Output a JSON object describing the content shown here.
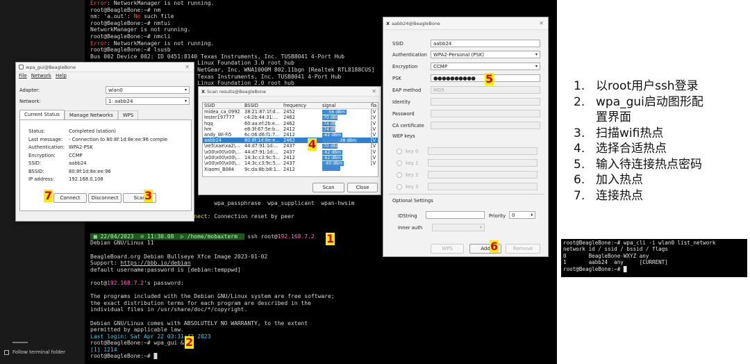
{
  "terminal": {
    "lines": [
      {
        "parts": [
          {
            "t": "Error",
            "c": "red"
          },
          {
            "t": ": NetworkManager is not running."
          }
        ]
      },
      {
        "parts": [
          {
            "t": "root@BeagleBone:~# nm"
          }
        ]
      },
      {
        "parts": [
          {
            "t": "nm: 'a.out': "
          },
          {
            "t": "No",
            "c": "red"
          },
          {
            "t": " such file"
          }
        ]
      },
      {
        "parts": [
          {
            "t": "root@BeagleBone:~# nmtui"
          }
        ]
      },
      {
        "parts": [
          {
            "t": "NetworkManager is not running."
          }
        ]
      },
      {
        "parts": [
          {
            "t": "root@BeagleBone:~# nmcli"
          }
        ]
      },
      {
        "parts": [
          {
            "t": "Error",
            "c": "red"
          },
          {
            "t": ": NetworkManager is not running."
          }
        ]
      },
      {
        "parts": [
          {
            "t": "root@BeagleBone:~# lsusb"
          }
        ]
      },
      {
        "parts": [
          {
            "t": "Bus 002 Device 002: ID 0451:8140 Texas Instruments, Inc. TUSB8041 4-Port Hub"
          }
        ]
      },
      {
        "parts": [
          {
            "t": "                                Linux Foundation 3.0 root hub"
          }
        ]
      },
      {
        "parts": [
          {
            "t": "                                NetGear, Inc. WNA1000M 802.11bgn [Realtek RTL8188CUS]"
          }
        ]
      },
      {
        "parts": [
          {
            "t": "                                Texas Instruments, Inc. TUSB8041 4-Port Hub"
          }
        ]
      },
      {
        "parts": [
          {
            "t": "                                Linux Foundation 2.0 root hub"
          }
        ]
      },
      {
        "parts": [
          {
            "t": ""
          }
        ]
      },
      {
        "parts": [
          {
            "t": ""
          }
        ]
      },
      {
        "parts": [
          {
            "t": ""
          }
        ]
      },
      {
        "parts": [
          {
            "t": ""
          }
        ]
      },
      {
        "parts": [
          {
            "t": ""
          }
        ]
      },
      {
        "parts": [
          {
            "t": ""
          }
        ]
      },
      {
        "parts": [
          {
            "t": ""
          }
        ]
      },
      {
        "parts": [
          {
            "t": ""
          }
        ]
      },
      {
        "parts": [
          {
            "t": ""
          }
        ]
      },
      {
        "parts": [
          {
            "t": ""
          }
        ]
      },
      {
        "parts": [
          {
            "t": ""
          }
        ]
      },
      {
        "parts": [
          {
            "t": ""
          }
        ]
      },
      {
        "parts": [
          {
            "t": ""
          }
        ]
      },
      {
        "parts": [
          {
            "t": ""
          }
        ]
      },
      {
        "parts": [
          {
            "t": ""
          }
        ]
      },
      {
        "parts": [
          {
            "t": ""
          }
        ]
      },
      {
        "parts": [
          {
            "t": ""
          }
        ]
      },
      {
        "parts": [
          {
            "t": "                    wpa_gui          wpa_passphrase  wpa_supplicant  wpan-hwsim"
          }
        ]
      },
      {
        "parts": [
          {
            "t": ""
          }
        ]
      },
      {
        "parts": [
          {
            "t": "                    send "
          },
          {
            "t": "disconnect",
            "c": "ylw"
          },
          {
            "t": ": Connection reset by peer"
          }
        ]
      },
      {
        "parts": [
          {
            "t": ""
          }
        ]
      },
      {
        "parts": [
          {
            "t": ""
          }
        ]
      },
      {
        "parts": [
          {
            "t": " ▦ 22/04/2023  ⊙ 11:30.08  ▷ /home/mobaxterm  ",
            "c": "grn"
          },
          {
            "t": " ssh root@"
          },
          {
            "t": "192.168.7.2",
            "c": "pink"
          }
        ]
      },
      {
        "parts": [
          {
            "t": "Debian GNU/Linux 11"
          }
        ]
      },
      {
        "parts": [
          {
            "t": ""
          }
        ]
      },
      {
        "parts": [
          {
            "t": "BeagleBoard.org Debian Bullseye Xfce Image 2023-01-02"
          }
        ]
      },
      {
        "parts": [
          {
            "t": "Support: "
          },
          {
            "t": "https://bbb.io/debian",
            "c": "ul"
          }
        ]
      },
      {
        "parts": [
          {
            "t": "default username:password is [debian:temppwd]"
          }
        ]
      },
      {
        "parts": [
          {
            "t": ""
          }
        ]
      },
      {
        "parts": [
          {
            "t": "root@"
          },
          {
            "t": "192.168.7.2",
            "c": "pink"
          },
          {
            "t": "'s password:"
          }
        ]
      },
      {
        "parts": [
          {
            "t": ""
          }
        ]
      },
      {
        "parts": [
          {
            "t": "The programs included with the Debian GNU/Linux system are free software;"
          }
        ]
      },
      {
        "parts": [
          {
            "t": "the exact distribution terms for each program are described in the"
          }
        ]
      },
      {
        "parts": [
          {
            "t": "individual files in /usr/share/doc/*/copyright."
          }
        ]
      },
      {
        "parts": [
          {
            "t": ""
          }
        ]
      },
      {
        "parts": [
          {
            "t": "Debian GNU/Linux comes with ABSOLUTELY NO WARRANTY, to the extent"
          }
        ]
      },
      {
        "parts": [
          {
            "t": "permitted by applicable law."
          }
        ]
      },
      {
        "parts": [
          {
            "t": "Last login: Sat Apr 22 03:31:41 2023",
            "c": "cyan"
          }
        ]
      },
      {
        "parts": [
          {
            "t": "root@BeagleBone:~# wpa_gui &"
          }
        ]
      },
      {
        "parts": [
          {
            "t": "[1] 1214",
            "c": "cyan"
          }
        ]
      },
      {
        "parts": [
          {
            "t": "root@BeagleBone:~# █"
          }
        ]
      }
    ]
  },
  "sidebar": {
    "follow_label": "Follow terminal folder"
  },
  "wpa_gui": {
    "title": "wpa_gui@BeagleBone",
    "menu": [
      "File",
      "Network",
      "Help"
    ],
    "adapter_label": "Adapter:",
    "adapter_value": "wlan0",
    "network_label": "Network:",
    "network_value": "1: aabb24",
    "tabs": [
      "Current Status",
      "Manage Networks",
      "WPS"
    ],
    "status": [
      {
        "k": "Status:",
        "v": "Completed (station)"
      },
      {
        "k": "Last message:",
        "v": "- Connection to 80:8f:1d:8e:ee:96 comple"
      },
      {
        "k": "Authentication:",
        "v": "WPA2-PSK"
      },
      {
        "k": "Encryption:",
        "v": "CCMP"
      },
      {
        "k": "SSID:",
        "v": "aabb24"
      },
      {
        "k": "BSSID:",
        "v": "80:8f:1d:8e:ee:96"
      },
      {
        "k": "IP address:",
        "v": "192.168.0.108"
      }
    ],
    "connect": "Connect",
    "disconnect": "Disconnect",
    "scan": "Scan"
  },
  "scan": {
    "title": "Scan results@BeagleBone",
    "headers": [
      "SSID",
      "BSSID",
      "frequency",
      "signal",
      "fla"
    ],
    "rows": [
      {
        "ssid": "midea_ca_0992",
        "bssid": "38:21:87:1f:d...",
        "freq": "2452",
        "signal": "-56 dBm",
        "pct": 0.55,
        "flag": "[V"
      },
      {
        "ssid": "lester197777",
        "bssid": "c4:2b:44:31:...",
        "freq": "2462",
        "signal": "-70 dBm",
        "pct": 0.35,
        "flag": "[V"
      },
      {
        "ssid": "hqq",
        "bssid": "60:aa:ef:2b:e...",
        "freq": "2462",
        "signal": "-74 dBm",
        "pct": 0.3,
        "flag": "[V"
      },
      {
        "ssid": "hm",
        "bssid": "e8:3f:67:5e:b...",
        "freq": "2412",
        "signal": "-74 dBm",
        "pct": 0.3,
        "flag": "[V"
      },
      {
        "ssid": "andy_Wi-Fi5",
        "bssid": "6c:06:d6:f1:7...",
        "freq": "2412",
        "signal": "-62 dBm",
        "pct": 0.45,
        "flag": "[V"
      },
      {
        "ssid": "aabb24",
        "bssid": "80:8f:1d:8e:e...",
        "freq": "2462",
        "signal": "-38 dBm",
        "pct": 0.8,
        "flag": "[V",
        "selected": true
      },
      {
        "ssid": "\\xe5\\xae\\xa2\\...",
        "bssid": "44:d7:91:1d:...",
        "freq": "2437",
        "signal": "-70 dBm",
        "pct": 0.35,
        "flag": "[V"
      },
      {
        "ssid": "\\x00\\x00\\x00\\...",
        "bssid": "44:d7:91:1d:...",
        "freq": "2437",
        "signal": "-62 dBm",
        "pct": 0.45,
        "flag": "[V"
      },
      {
        "ssid": "\\x00\\x00\\x00\\...",
        "bssid": "14:3c:c3:9c:5...",
        "freq": "2412",
        "signal": "-62 dBm",
        "pct": 0.45,
        "flag": "[V"
      },
      {
        "ssid": "\\x00\\x00\\x00\\...",
        "bssid": "14:3c:c3:9c:5...",
        "freq": "2437",
        "signal": "-60 dBm",
        "pct": 0.48,
        "flag": "[V"
      },
      {
        "ssid": "Xiaomi_B084",
        "bssid": "9c:da:8b:b8:1...",
        "freq": "2412",
        "signal": "",
        "pct": 0.4,
        "flag": ""
      }
    ],
    "scan_btn": "Scan",
    "close_btn": "Close"
  },
  "netcfg": {
    "title": "aabb24@BeagleBone",
    "ssid_label": "SSID",
    "ssid_value": "aabb24",
    "auth_label": "Authentication",
    "auth_value": "WPA2-Personal (PSK)",
    "enc_label": "Encryption",
    "enc_value": "CCMP",
    "psk_label": "PSK",
    "psk_value": "●●●●●●●●●●",
    "eap_label": "EAP method",
    "eap_value": "MD5",
    "identity_label": "Identity",
    "password_label": "Password",
    "ca_label": "CA certificate",
    "wep_label": "WEP keys",
    "keys": [
      "key 0",
      "key 1",
      "key 2",
      "key 3"
    ],
    "optional_label": "Optional Settings",
    "idstring_label": "IDString",
    "priority_label": "Priority",
    "priority_value": "0",
    "inner_auth_label": "Inner auth",
    "wps_btn": "WPS",
    "add_btn": "Add",
    "remove_btn": "Remove"
  },
  "markers": [
    "1",
    "2",
    "3",
    "4",
    "5",
    "6",
    "7"
  ],
  "steps": [
    {
      "n": "1.",
      "t": "以root用户ssh登录"
    },
    {
      "n": "2.",
      "t": "wpa_gui启动图形配"
    },
    {
      "n": "",
      "t": "置界面"
    },
    {
      "n": "3.",
      "t": "扫描wifi热点"
    },
    {
      "n": "4.",
      "t": "选择合适热点"
    },
    {
      "n": "5.",
      "t": "输入待连接热点密码"
    },
    {
      "n": "6.",
      "t": "加入热点"
    },
    {
      "n": "7.",
      "t": "连接热点"
    }
  ],
  "cli": [
    "root@BeagleBone:~# wpa_cli -i wlan0 list_network",
    "network id / ssid / bssid / flags",
    "0       BeagleBone-WXYZ any",
    "1       aabb24  any     [CURRENT]",
    "root@BeagleBone:~# █"
  ]
}
